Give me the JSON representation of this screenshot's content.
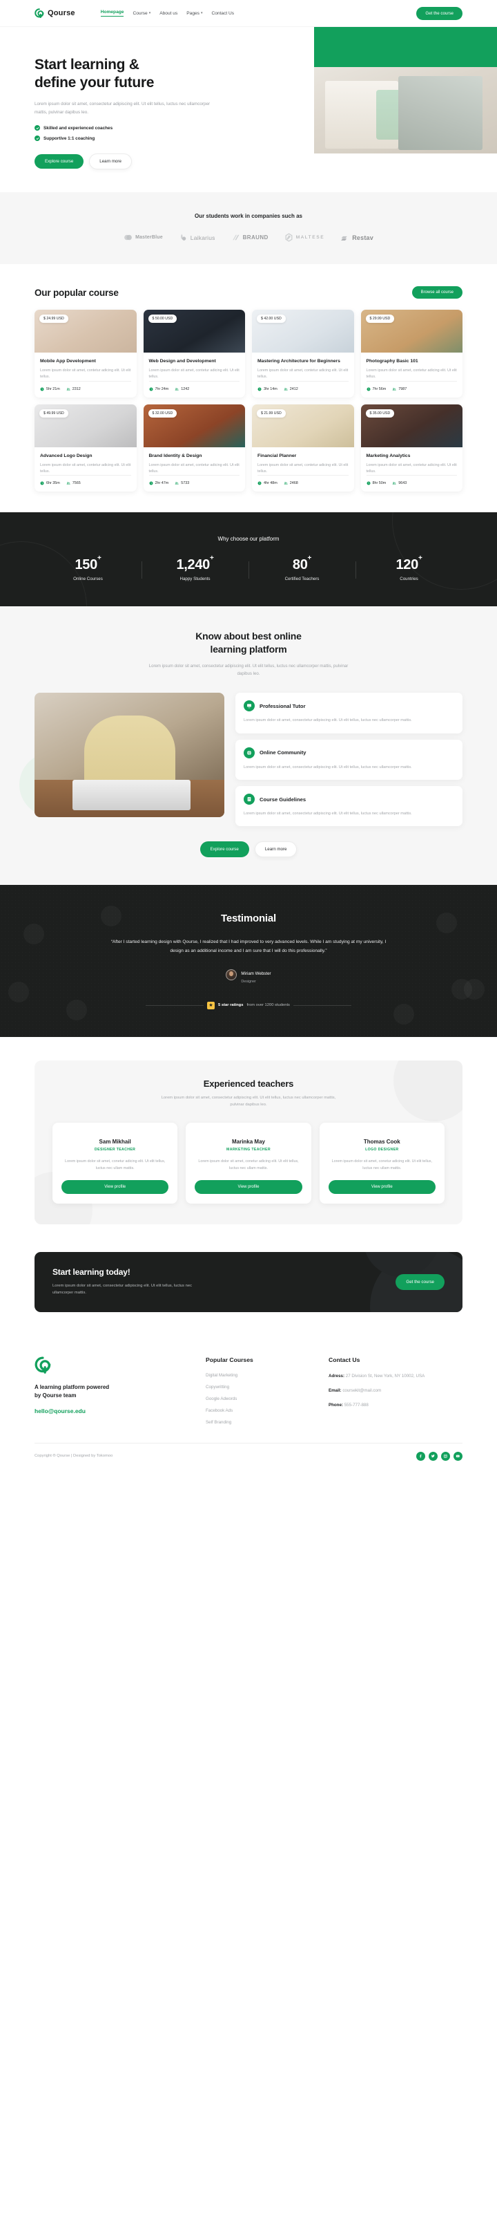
{
  "brand": {
    "name": "Qourse",
    "accent": "#12a05c",
    "dark": "#1d1f1e"
  },
  "header": {
    "nav": [
      {
        "label": "Homepage",
        "caret": false,
        "active": true
      },
      {
        "label": "Course",
        "caret": true,
        "active": false
      },
      {
        "label": "About us",
        "caret": false,
        "active": false
      },
      {
        "label": "Pages",
        "caret": true,
        "active": false
      },
      {
        "label": "Contact Us",
        "caret": false,
        "active": false
      }
    ],
    "cta": "Get the course"
  },
  "hero": {
    "title_line1": "Start learning &",
    "title_line2": "define your future",
    "subtitle": "Lorem ipsum dolor sit amet, consectetur adipiscing elit. Ut elit tellus, luctus nec ullamcorper mattis, pulvinar dapibus leo.",
    "features": [
      "Skilled and experienced coaches",
      "Supportive 1:1 coaching"
    ],
    "primary_btn": "Explore course",
    "secondary_btn": "Learn more"
  },
  "logos": {
    "title": "Our students work in companies such as",
    "brands": [
      {
        "name": "MasterBlue",
        "icon": "circles-logo-icon"
      },
      {
        "name": "Laikarius",
        "icon": "droplet-logo-icon"
      },
      {
        "name": "BRAUND",
        "icon": "slashes-logo-icon"
      },
      {
        "name": "MALTESE",
        "icon": "hexagon-logo-icon"
      },
      {
        "name": "Restav",
        "icon": "bolt-logo-icon"
      }
    ]
  },
  "courses": {
    "title": "Our popular course",
    "browse_btn": "Browse all course",
    "items": [
      {
        "price": "$ 24.99 USD",
        "title": "Mobile App Development",
        "desc": "Lorem ipsum dolor sit amet, contetur adicing elit. Ut elit tellus.",
        "duration": "5hr 21m",
        "students": "2312"
      },
      {
        "price": "$ 50.00 USD",
        "title": "Web Design and Development",
        "desc": "Lorem ipsum dolor sit amet, contetur adicing elit. Ut elit tellus.",
        "duration": "7hr 24m",
        "students": "1242"
      },
      {
        "price": "$ 42.00 USD",
        "title": "Mastering Architecture for Beginners",
        "desc": "Lorem ipsum dolor sit amet, contetur adicing elit. Ut elit tellus.",
        "duration": "3hr 14m",
        "students": "2412"
      },
      {
        "price": "$ 29.99 USD",
        "title": "Photography Basic 101",
        "desc": "Lorem ipsum dolor sit amet, contetur adicing elit. Ut elit tellus.",
        "duration": "7hr 56m",
        "students": "7987"
      },
      {
        "price": "$ 49.99 USD",
        "title": "Advanced Logo Design",
        "desc": "Lorem ipsum dolor sit amet, contetur adicing elit. Ut elit tellus.",
        "duration": "6hr 35m",
        "students": "7565"
      },
      {
        "price": "$ 32.00 USD",
        "title": "Brand Identity & Design",
        "desc": "Lorem ipsum dolor sit amet, contetur adicing elit. Ut elit tellus.",
        "duration": "2hr 47m",
        "students": "5733"
      },
      {
        "price": "$ 21.99 USD",
        "title": "Financial Planner",
        "desc": "Lorem ipsum dolor sit amet, contetur adicing elit. Ut elit tellus.",
        "duration": "4hr 48m",
        "students": "2468"
      },
      {
        "price": "$ 35.00 USD",
        "title": "Marketing Analytics",
        "desc": "Lorem ipsum dolor sit amet, contetur adicing elit. Ut elit tellus.",
        "duration": "8hr 50m",
        "students": "9643"
      }
    ]
  },
  "stats": {
    "title": "Why choose our platform",
    "items": [
      {
        "value": "150",
        "sup": "+",
        "label": "Online Courses"
      },
      {
        "value": "1,240",
        "sup": "+",
        "label": "Happy Students"
      },
      {
        "value": "80",
        "sup": "+",
        "label": "Certified Teachers"
      },
      {
        "value": "120",
        "sup": "+",
        "label": "Countries"
      }
    ]
  },
  "know": {
    "title_line1": "Know about best online",
    "title_line2": "learning platform",
    "subtitle": "Lorem ipsum dolor sit amet, consectetur adipiscing elit. Ut elit tellus, luctus nec ullamcorper mattis, pulvinar dapibus leo.",
    "features": [
      {
        "icon": "presenter-icon",
        "title": "Professional Tutor",
        "desc": "Lorem ipsum dolor sit amet, consectetur adipiscing elit. Ut elit tellus, luctus nec ullamcorper mattis."
      },
      {
        "icon": "globe-icon",
        "title": "Online Community",
        "desc": "Lorem ipsum dolor sit amet, consectetur adipiscing elit. Ut elit tellus, luctus nec ullamcorper mattis."
      },
      {
        "icon": "book-icon",
        "title": "Course Guidelines",
        "desc": "Lorem ipsum dolor sit amet, consectetur adipiscing elit. Ut elit tellus, luctus nec ullamcorper mattis."
      }
    ],
    "primary_btn": "Explore course",
    "secondary_btn": "Learn more"
  },
  "testimonial": {
    "title": "Testimonial",
    "quote": "“After I started learning design with Qourse, I realized that I had improved to very advanced levels. While I am studying at my university, I design as an additional income and I am sure that I will do this professionally.”",
    "author_name": "Miriam Webster",
    "author_role": "Designer",
    "rating_text": "5 star ratings",
    "rating_sub": "from over  1200 students"
  },
  "teachers": {
    "title": "Experienced teachers",
    "subtitle": "Lorem ipsum dolor sit amet, consectetur adipiscing elit. Ut elit tellus, luctus nec ullamcorper mattis, pulvinar dapibus leo.",
    "items": [
      {
        "name": "Sam Mikhail",
        "role": "DESIGNER TEACHER",
        "desc": "Lorem ipsum dolor sit amet, conetur adicing elit. Ut elit tellus, luctus nec ullam mattis.",
        "btn": "View profile"
      },
      {
        "name": "Marinka May",
        "role": "MARKETING TEACHER",
        "desc": "Lorem ipsum dolor sit amet, conetur adicing elit. Ut elit tellus, luctus nec ullam mattis.",
        "btn": "View profile"
      },
      {
        "name": "Thomas Cook",
        "role": "LOGO DESIGNER",
        "desc": "Lorem ipsum dolor sit amet, conetur adicing elit. Ut elit tellus, luctus nec ullam mattis.",
        "btn": "View profile"
      }
    ]
  },
  "cta_band": {
    "title": "Start learning today!",
    "desc": "Lorem ipsum dolor sit amet, consectetur adipiscing elit. Ut elit tellus, luctus nec ullamcorper mattis.",
    "btn": "Get the course"
  },
  "footer": {
    "tagline_line1": "A learning platform powered",
    "tagline_line2": "by Qourse team",
    "email": "hello@qourse.edu",
    "courses_heading": "Popular Courses",
    "courses_links": [
      "Digital Marketing",
      "Copywritting",
      "Google Adwords",
      "Facebook Ads",
      "Self Branding"
    ],
    "contact_heading": "Contact Us",
    "address_label": "Adress:",
    "address_value": "27 Division St, New York, NY 10002, USA",
    "email_label": "Email:",
    "email_value": "coursekit@mail.com",
    "phone_label": "Phone:",
    "phone_value": "555-777-888",
    "copyright": "Copyright ® Qourse | Designed by Tokomoo",
    "socials": [
      "facebook-icon",
      "twitter-icon",
      "instagram-icon",
      "youtube-icon"
    ]
  }
}
